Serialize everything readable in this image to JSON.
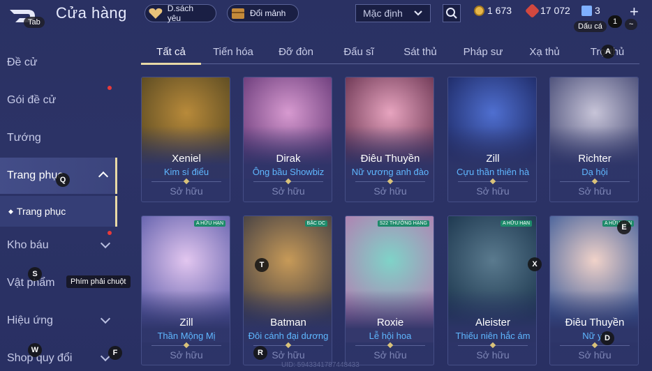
{
  "header": {
    "title": "Cửa hàng",
    "back_hint": "Tab",
    "wishlist_label": "D.sách yêu",
    "exchange_label": "Đổi mảnh",
    "sort_selected": "Mặc định",
    "currency": [
      {
        "value": "1 673",
        "color": "#e8b84a"
      },
      {
        "value": "17 072",
        "color": "#d2483f"
      },
      {
        "value": "3",
        "color": "#7fb0ff"
      }
    ],
    "dau_ca_hint": "Dấu cá",
    "badge_count": "1",
    "tilde_hint": "~",
    "plus_label": "+"
  },
  "tabs": [
    "Tất cả",
    "Tiến hóa",
    "Đỡ đòn",
    "Đấu sĩ",
    "Sát thủ",
    "Pháp sư",
    "Xạ thủ",
    "Trợ thủ"
  ],
  "sidebar": {
    "items": [
      {
        "label": "Đề cử"
      },
      {
        "label": "Gói đề cử"
      },
      {
        "label": "Tướng"
      },
      {
        "label": "Trang phục"
      },
      {
        "label": "Kho báu"
      },
      {
        "label": "Vật phẩm"
      },
      {
        "label": "Hiệu ứng"
      },
      {
        "label": "Shop quy đổi"
      }
    ],
    "sub_label": "Trang phục"
  },
  "cards": [
    {
      "hero": "Xeniel",
      "skin": "Kim sí điểu",
      "status": "Sở hữu",
      "colors": [
        "#5a4a22",
        "#b88a3a"
      ]
    },
    {
      "hero": "Dirak",
      "skin": "Ông bầu Showbiz",
      "status": "Sở hữu",
      "colors": [
        "#6a3b7a",
        "#d79ad0"
      ]
    },
    {
      "hero": "Điêu Thuyền",
      "skin": "Nữ vương anh đào",
      "status": "Sở hữu",
      "colors": [
        "#6b3552",
        "#e7a4bf"
      ]
    },
    {
      "hero": "Zill",
      "skin": "Cựu thần thiên hà",
      "status": "Sở hữu",
      "colors": [
        "#1e2a66",
        "#4f6fd0"
      ]
    },
    {
      "hero": "Richter",
      "skin": "Dạ hội",
      "status": "Sở hữu",
      "colors": [
        "#4a4e78",
        "#c7c4d8"
      ]
    },
    {
      "hero": "Zill",
      "skin": "Thần Mộng Mị",
      "status": "Sở hữu",
      "colors": [
        "#5a5aa8",
        "#e2c6ef"
      ],
      "tag": "A HỮU HẠN"
    },
    {
      "hero": "Batman",
      "skin": "Đôi cánh đại dương",
      "status": "Sở hữu",
      "colors": [
        "#3c3a42",
        "#c79a58"
      ],
      "tag": "BẬC DC"
    },
    {
      "hero": "Roxie",
      "skin": "Lễ hội hoa",
      "status": "Sở hữu",
      "colors": [
        "#b57ab0",
        "#7fd3c8"
      ],
      "tag": "S22 THƯỞNG HẠNG"
    },
    {
      "hero": "Aleister",
      "skin": "Thiếu niên hắc ám",
      "status": "Sở hữu",
      "colors": [
        "#18324a",
        "#5a7a8e"
      ],
      "tag": "A HỮU HẠN"
    },
    {
      "hero": "Điêu Thuyền",
      "skin": "Nữ y t",
      "status": "Sở hữu",
      "colors": [
        "#3b5a98",
        "#f0d2c9"
      ],
      "tag": "A HỮU HẠN"
    }
  ],
  "hints": {
    "q": "Q",
    "s": "S",
    "w": "W",
    "f": "F",
    "t": "T",
    "r": "R",
    "x": "X",
    "e": "E",
    "d": "D",
    "a": "A",
    "right_click": "Phím phải chuột"
  },
  "uid": "UID: 5943341787448433"
}
